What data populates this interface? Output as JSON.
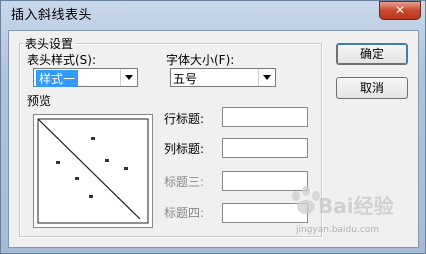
{
  "window": {
    "title": "插入斜线表头",
    "close_glyph": "✕"
  },
  "group": {
    "title": "表头设置"
  },
  "style_combo": {
    "label": "表头样式(S):",
    "value": "样式一"
  },
  "font_combo": {
    "label": "字体大小(F):",
    "value": "五号"
  },
  "preview": {
    "label": "预览"
  },
  "fields": {
    "row_title": "行标题:",
    "col_title": "列标题:",
    "title3": "标题三:",
    "title4": "标题四:"
  },
  "buttons": {
    "ok": "确定",
    "cancel": "取消"
  },
  "watermark": {
    "brand": "Bai经验",
    "url": "jingyan.baidu.com"
  }
}
